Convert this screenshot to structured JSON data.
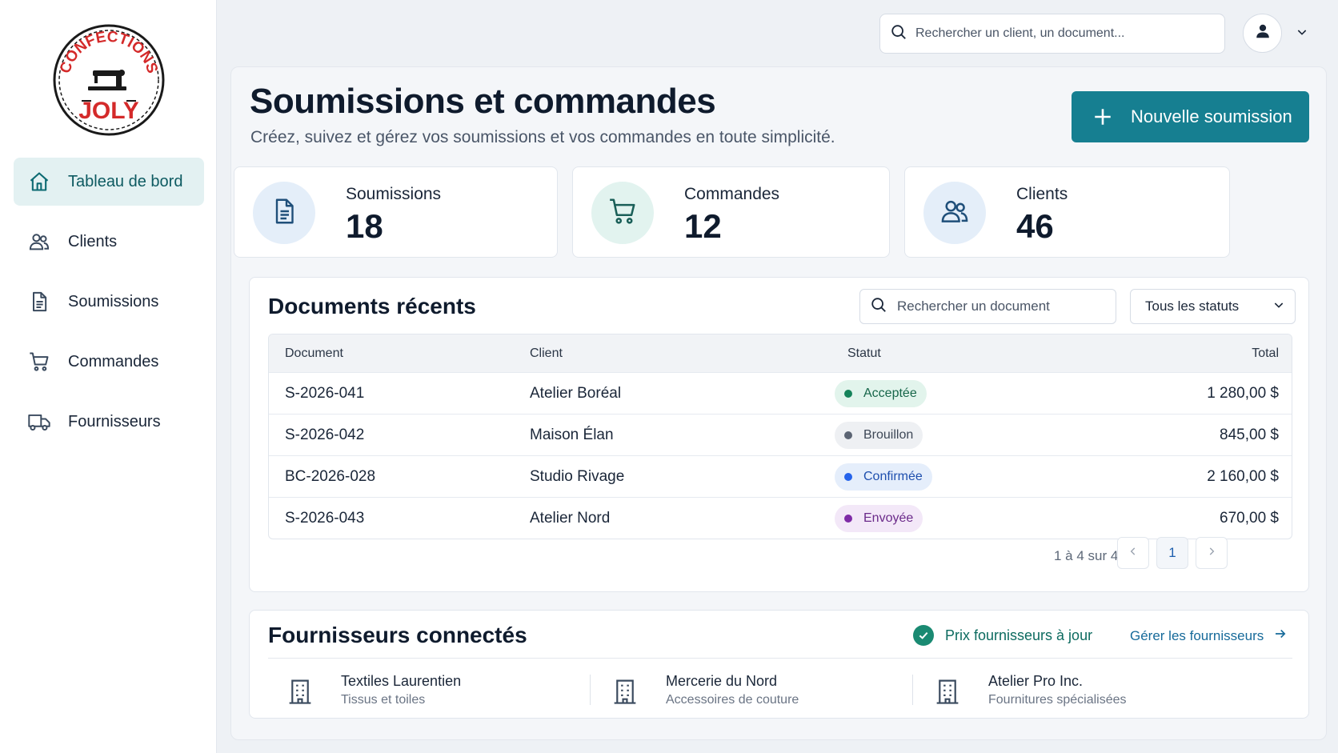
{
  "logo": {
    "top_text": "CONFECTIONS",
    "bottom_text": "JOLY",
    "brand_color": "#d42a2a"
  },
  "sidebar": {
    "items": [
      {
        "label": "Tableau de bord",
        "icon": "home-icon",
        "active": true
      },
      {
        "label": "Clients",
        "icon": "users-icon",
        "active": false
      },
      {
        "label": "Soumissions",
        "icon": "document-icon",
        "active": false
      },
      {
        "label": "Commandes",
        "icon": "cart-icon",
        "active": false
      },
      {
        "label": "Fournisseurs",
        "icon": "truck-icon",
        "active": false
      }
    ]
  },
  "topbar": {
    "search_placeholder": "Rechercher un client, un document..."
  },
  "header": {
    "title": "Soumissions et commandes",
    "subtitle": "Créez, suivez et gérez vos soumissions et vos commandes en toute simplicité.",
    "new_button": "Nouvelle soumission"
  },
  "stats": [
    {
      "label": "Soumissions",
      "value": "18",
      "icon": "document-icon",
      "bg": "#e4eef9",
      "fg": "#1f4f7a"
    },
    {
      "label": "Commandes",
      "value": "12",
      "icon": "cart-icon",
      "bg": "#e2f3ef",
      "fg": "#1a5f58"
    },
    {
      "label": "Clients",
      "value": "46",
      "icon": "users-icon",
      "bg": "#e4eef9",
      "fg": "#1f4f7a"
    }
  ],
  "documents": {
    "title": "Documents récents",
    "search_placeholder": "Rechercher un document",
    "status_filter": "Tous les statuts",
    "columns": [
      "Document",
      "Client",
      "Statut",
      "Total"
    ],
    "rows": [
      {
        "doc": "S-2026-041",
        "client": "Atelier Boréal",
        "status": "Acceptée",
        "total": "1 280,00 $",
        "badge_bg": "#e2f4ec",
        "badge_fg": "#17664a",
        "dot": "#15835a"
      },
      {
        "doc": "S-2026-042",
        "client": "Maison Élan",
        "status": "Brouillon",
        "total": "845,00 $",
        "badge_bg": "#eef0f3",
        "badge_fg": "#3d4756",
        "dot": "#5b6473"
      },
      {
        "doc": "BC-2026-028",
        "client": "Studio Rivage",
        "status": "Confirmée",
        "total": "2 160,00 $",
        "badge_bg": "#e5eefb",
        "badge_fg": "#1e4fae",
        "dot": "#2563eb"
      },
      {
        "doc": "S-2026-043",
        "client": "Atelier Nord",
        "status": "Envoyée",
        "total": "670,00 $",
        "badge_bg": "#f3e8f8",
        "badge_fg": "#6b2a8a",
        "dot": "#7e2aa6"
      }
    ],
    "pagination": {
      "summary": "1 à 4 sur 4",
      "current_page": "1"
    }
  },
  "suppliers": {
    "title": "Fournisseurs connectés",
    "status": "Prix fournisseurs à jour",
    "manage_link": "Gérer les fournisseurs",
    "items": [
      {
        "name": "Textiles Laurentien",
        "desc": "Tissus et toiles"
      },
      {
        "name": "Mercerie du Nord",
        "desc": "Accessoires de couture"
      },
      {
        "name": "Atelier Pro Inc.",
        "desc": "Fournitures spécialisées"
      }
    ]
  }
}
